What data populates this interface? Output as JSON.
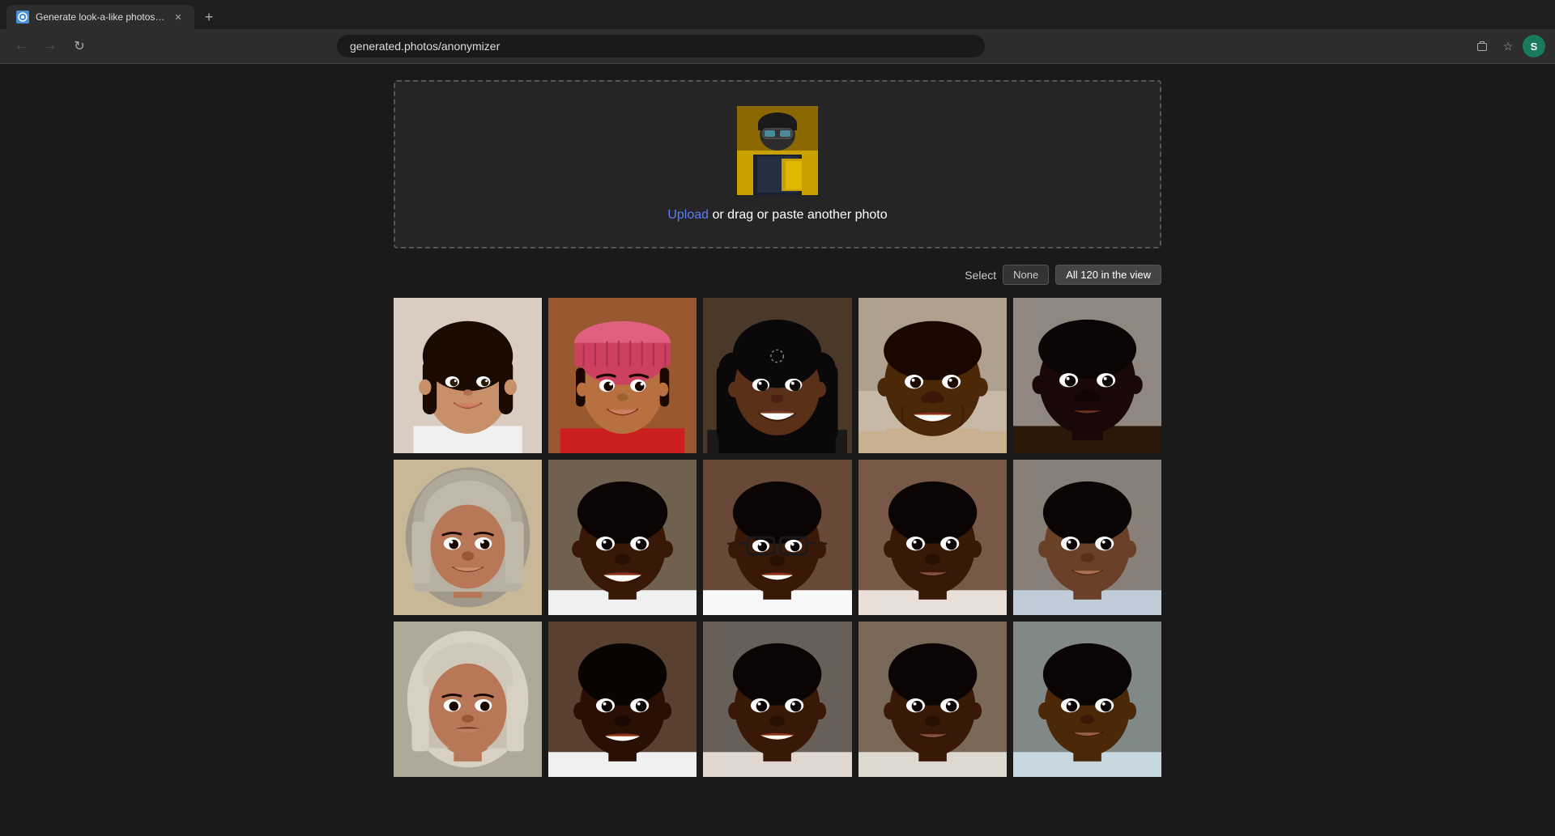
{
  "browser": {
    "tab_title": "Generate look-a-like photos to p",
    "url": "generated.photos/anonymizer",
    "new_tab_label": "+"
  },
  "upload": {
    "link_text": "Upload",
    "rest_text": " or drag or paste another photo"
  },
  "controls": {
    "select_label": "Select",
    "none_label": "None",
    "all_label": "All 120 in the view"
  },
  "photos": {
    "row1": [
      {
        "id": 1,
        "desc": "young girl smiling",
        "skin": "medium",
        "bg": "#d4b898"
      },
      {
        "id": 2,
        "desc": "woman with red hat",
        "skin": "medium-dark",
        "bg": "#c8956a"
      },
      {
        "id": 3,
        "desc": "young woman dark skin",
        "skin": "dark",
        "bg": "#6a4030"
      },
      {
        "id": 4,
        "desc": "man dark skin smiling",
        "skin": "dark",
        "bg": "#786050"
      },
      {
        "id": 5,
        "desc": "man very dark skin",
        "skin": "very-dark",
        "bg": "#8a8880"
      }
    ],
    "row2": [
      {
        "id": 6,
        "desc": "woman with headscarf",
        "skin": "medium",
        "bg": "#c8b090"
      },
      {
        "id": 7,
        "desc": "woman dark skin smiling",
        "skin": "dark",
        "bg": "#705040"
      },
      {
        "id": 8,
        "desc": "woman with glasses",
        "skin": "dark",
        "bg": "#6a4838"
      },
      {
        "id": 9,
        "desc": "woman dark skin neutral",
        "skin": "dark",
        "bg": "#7a5848"
      },
      {
        "id": 10,
        "desc": "woman medium dark skin",
        "skin": "medium-dark",
        "bg": "#888078"
      }
    ]
  }
}
